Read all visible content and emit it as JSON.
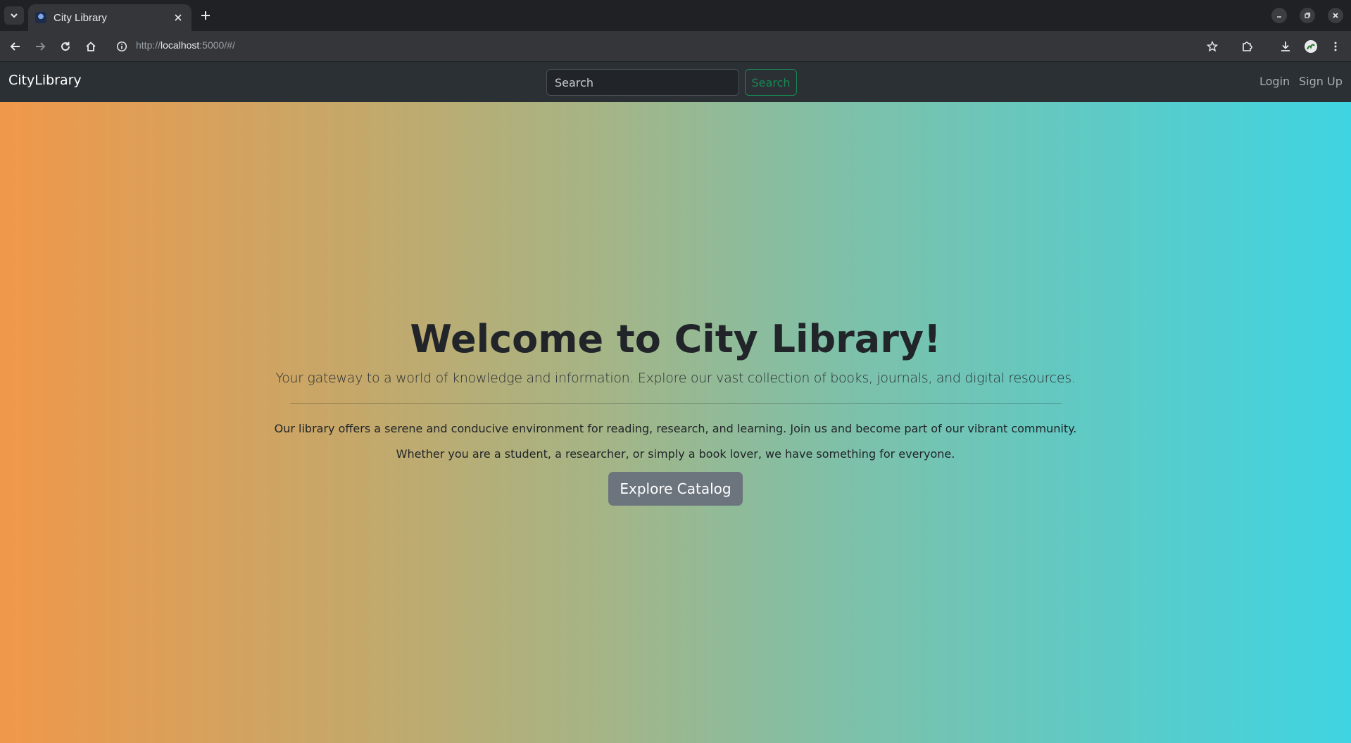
{
  "browser": {
    "tab_title": "City Library",
    "url_scheme": "http://",
    "url_host": "localhost",
    "url_rest": ":5000/#/"
  },
  "navbar": {
    "brand": "CityLibrary",
    "search_placeholder": "Search",
    "search_button": "Search",
    "login": "Login",
    "signup": "Sign Up"
  },
  "hero": {
    "title": "Welcome to City Library!",
    "lead": "Your gateway to a world of knowledge and information. Explore our vast collection of books, journals, and digital resources.",
    "paragraph1": "Our library offers a serene and conducive environment for reading, research, and learning. Join us and become part of our vibrant community.",
    "paragraph2": "Whether you are a student, a researcher, or simply a book lover, we have something for everyone.",
    "button": "Explore Catalog"
  },
  "colors": {
    "gradient_start": "#f0984a",
    "gradient_end": "#3fd4e2",
    "navbar_bg": "#2b3035",
    "search_button_accent": "#198754",
    "explore_button_bg": "#6c757d"
  }
}
